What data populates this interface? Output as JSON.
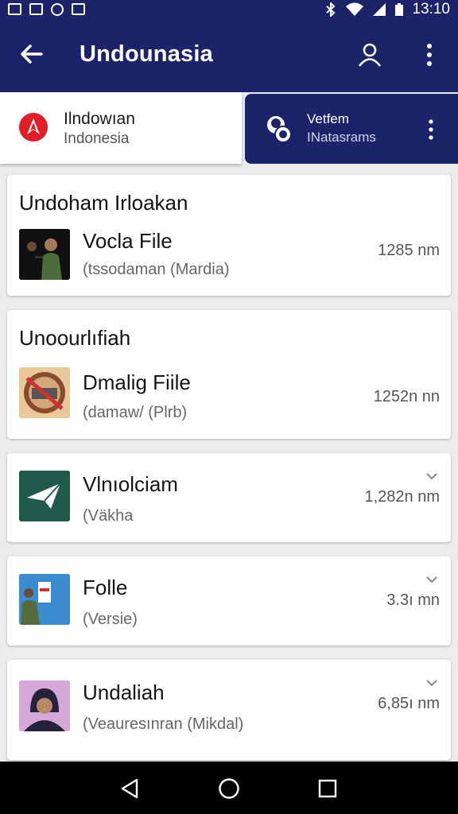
{
  "status_bar": {
    "time": "13:10",
    "icons": [
      "image-icon",
      "gallery-icon",
      "sync-icon",
      "photo-icon",
      "bluetooth-icon",
      "wifi-icon",
      "signal-icon",
      "battery-icon"
    ]
  },
  "app_bar": {
    "title": "Undounasia",
    "back_icon": "back-arrow-icon",
    "user_icon": "user-icon",
    "more_icon": "more-vert-icon"
  },
  "tabs": {
    "left": {
      "line1": "Ilndowıan",
      "line2": "Indonesia",
      "icon": "brand-logo-icon"
    },
    "right": {
      "line1": "Vetfem",
      "line2": "INatasrams",
      "icon": "profile-chat-icon"
    }
  },
  "sections": [
    {
      "title": "Undoham Irloakan",
      "items": [
        {
          "name": "Vocla File",
          "sub": "(tssodaman (Mardia)",
          "size": "1285 nm",
          "thumb": "performer-photo"
        }
      ]
    },
    {
      "title": "Unoourlıfiah",
      "items": [
        {
          "name": "Dmalig Fiile",
          "sub": "(damaw/ (Plrb)",
          "size": "1252n nn",
          "thumb": "stamp-photo"
        }
      ]
    }
  ],
  "files": [
    {
      "name": "Vlnıolciam",
      "sub": "(Väkha",
      "size": "1,282n nm",
      "thumb": "paper-plane-app-icon",
      "chevron": "chevron-down-icon"
    },
    {
      "name": "Folle",
      "sub": "(Versie)",
      "size": "3.3ı mn",
      "thumb": "person-sign-photo",
      "chevron": "chevron-down-icon"
    },
    {
      "name": "Undaliah",
      "sub": "(Veauresınran (Mikdal)",
      "size": "6,85ı nm",
      "thumb": "hooded-person-photo",
      "chevron": "chevron-down-icon"
    }
  ],
  "nav_bar": {
    "icons": [
      "back-triangle-icon",
      "home-circle-icon",
      "recents-square-icon"
    ]
  },
  "colors": {
    "primary": "#1c2369",
    "background": "#ececec",
    "brand_red": "#e11e26",
    "app_green": "#1f5a4a"
  }
}
